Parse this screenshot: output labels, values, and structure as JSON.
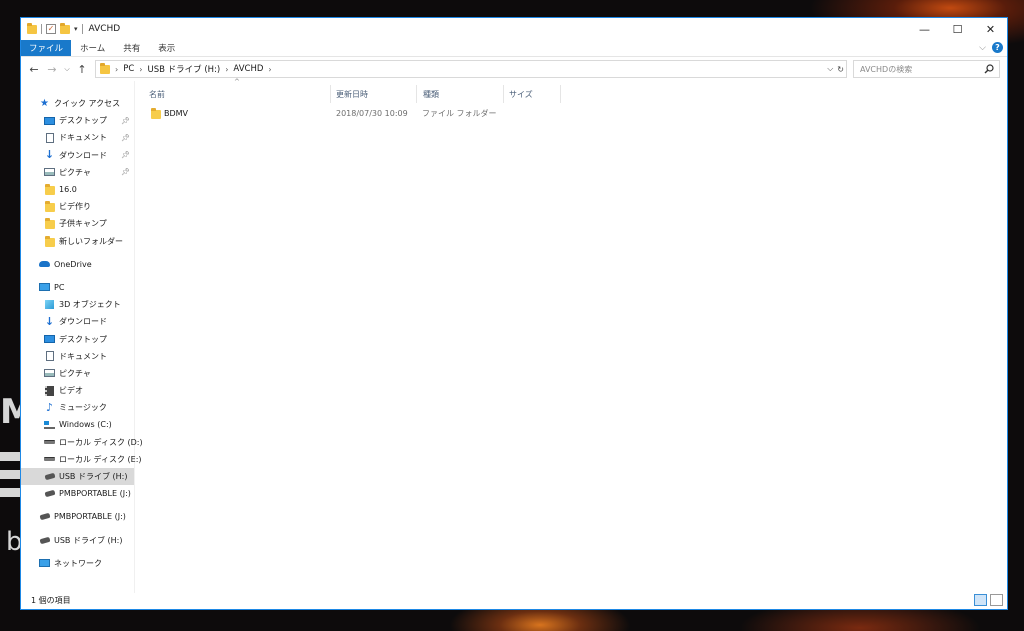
{
  "window": {
    "title": "AVCHD"
  },
  "ribbon": {
    "tabs": [
      {
        "label": "ファイル"
      },
      {
        "label": "ホーム"
      },
      {
        "label": "共有"
      },
      {
        "label": "表示"
      }
    ]
  },
  "address": {
    "breadcrumbs": [
      "PC",
      "USB ドライブ (H:)",
      "AVCHD"
    ]
  },
  "search": {
    "placeholder": "AVCHDの検索"
  },
  "nav": {
    "quick_access": {
      "label": "クイック アクセス",
      "items": [
        {
          "label": "デスクトップ",
          "icon": "desktop-icon",
          "pinned": true
        },
        {
          "label": "ドキュメント",
          "icon": "document-icon",
          "pinned": true
        },
        {
          "label": "ダウンロード",
          "icon": "download-icon",
          "pinned": true
        },
        {
          "label": "ピクチャ",
          "icon": "picture-icon",
          "pinned": true
        },
        {
          "label": "16.0",
          "icon": "folder-icon"
        },
        {
          "label": "ビデ作り",
          "icon": "folder-icon"
        },
        {
          "label": "子供キャンプ",
          "icon": "folder-icon"
        },
        {
          "label": "新しいフォルダー",
          "icon": "folder-icon"
        }
      ]
    },
    "onedrive": {
      "label": "OneDrive"
    },
    "pc": {
      "label": "PC",
      "items": [
        {
          "label": "3D オブジェクト",
          "icon": "3d-objects-icon"
        },
        {
          "label": "ダウンロード",
          "icon": "download-icon"
        },
        {
          "label": "デスクトップ",
          "icon": "desktop-icon"
        },
        {
          "label": "ドキュメント",
          "icon": "document-icon"
        },
        {
          "label": "ピクチャ",
          "icon": "picture-icon"
        },
        {
          "label": "ビデオ",
          "icon": "video-icon"
        },
        {
          "label": "ミュージック",
          "icon": "music-icon"
        },
        {
          "label": "Windows (C:)",
          "icon": "windows-drive-icon"
        },
        {
          "label": "ローカル ディスク (D:)",
          "icon": "drive-icon"
        },
        {
          "label": "ローカル ディスク (E:)",
          "icon": "drive-icon"
        },
        {
          "label": "USB ドライブ (H:)",
          "icon": "usb-drive-icon"
        },
        {
          "label": "PMBPORTABLE (J:)",
          "icon": "usb-drive-icon"
        }
      ]
    },
    "drives": [
      {
        "label": "PMBPORTABLE (J:)",
        "icon": "usb-drive-icon"
      },
      {
        "label": "USB ドライブ (H:)",
        "icon": "usb-drive-icon"
      }
    ],
    "network": {
      "label": "ネットワーク"
    }
  },
  "columns": [
    {
      "label": "名前"
    },
    {
      "label": "更新日時"
    },
    {
      "label": "種類"
    },
    {
      "label": "サイズ"
    }
  ],
  "files": [
    {
      "name": "BDMV",
      "modified": "2018/07/30 10:09",
      "type": "ファイル フォルダー",
      "size": ""
    }
  ],
  "status": {
    "item_count": "1 個の項目"
  },
  "colors": {
    "accent": "#1979ca",
    "selection": "#d9d9d9",
    "folder": "#f7cd4b"
  }
}
